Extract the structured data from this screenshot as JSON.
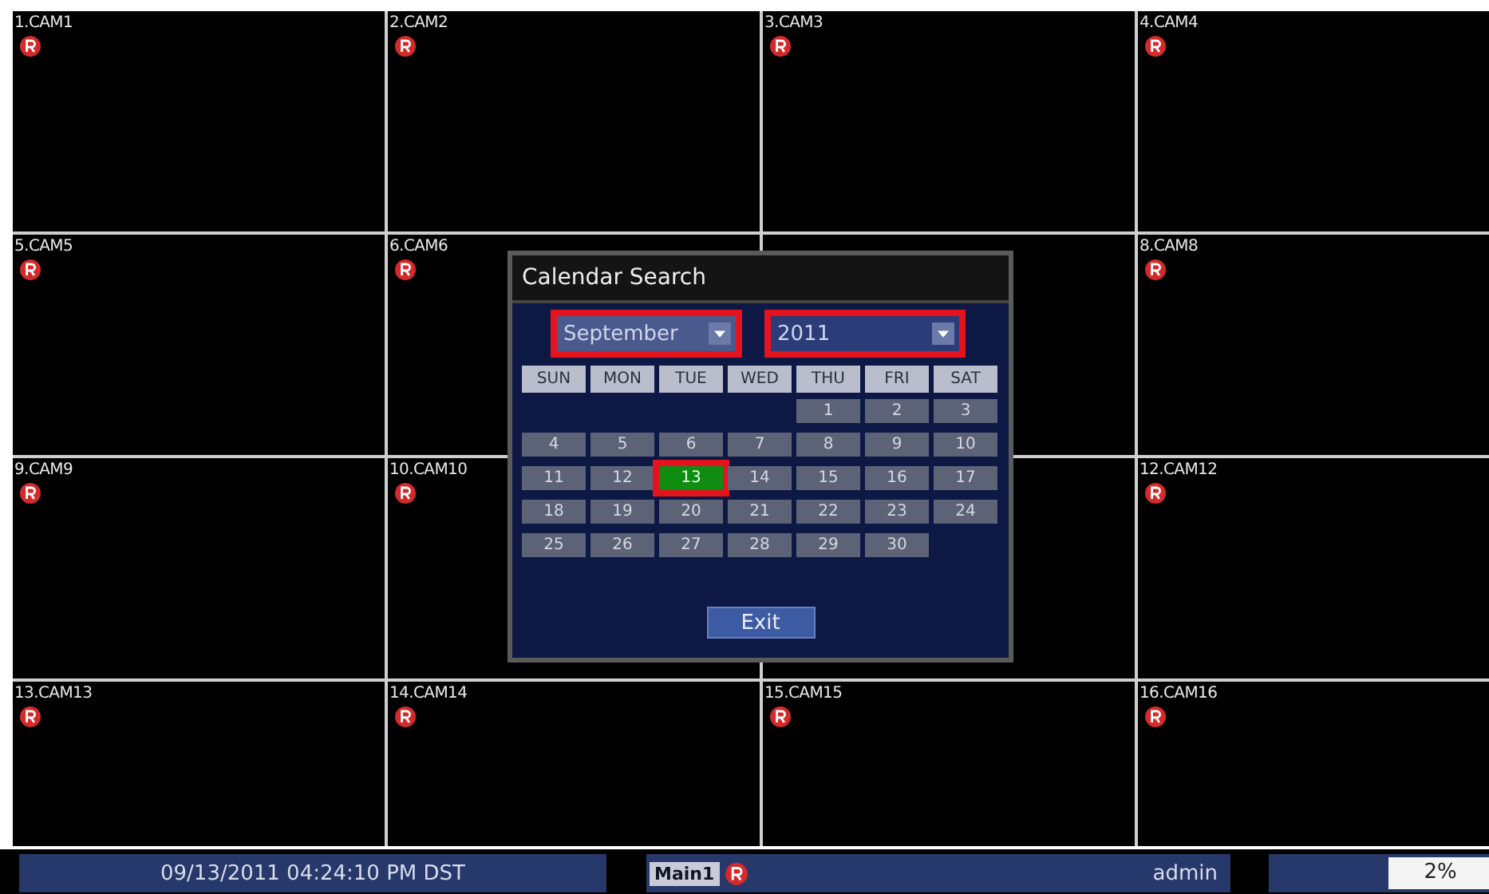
{
  "cameras": [
    {
      "label": "1.CAM1",
      "recording": true
    },
    {
      "label": "2.CAM2",
      "recording": true
    },
    {
      "label": "3.CAM3",
      "recording": true
    },
    {
      "label": "4.CAM4",
      "recording": true
    },
    {
      "label": "5.CAM5",
      "recording": true
    },
    {
      "label": "6.CAM6",
      "recording": true
    },
    {
      "recording": false
    },
    {
      "label": "8.CAM8",
      "recording": true
    },
    {
      "label": "9.CAM9",
      "recording": true
    },
    {
      "label": "10.CAM10",
      "recording": true
    },
    {
      "recording": false
    },
    {
      "label": "12.CAM12",
      "recording": true
    },
    {
      "label": "13.CAM13",
      "recording": true
    },
    {
      "label": "14.CAM14",
      "recording": true
    },
    {
      "label": "15.CAM15",
      "recording": true
    },
    {
      "label": "16.CAM16",
      "recording": true
    }
  ],
  "dialog": {
    "title": "Calendar Search",
    "month": {
      "value": "September",
      "highlighted": true
    },
    "year": {
      "value": "2011",
      "highlighted": true
    },
    "weekdays": [
      "SUN",
      "MON",
      "TUE",
      "WED",
      "THU",
      "FRI",
      "SAT"
    ],
    "weeks": [
      [
        {
          "kind": "blank"
        },
        {
          "kind": "blank"
        },
        {
          "kind": "blank"
        },
        {
          "kind": "blank"
        },
        {
          "day": "1",
          "selected": false
        },
        {
          "day": "2",
          "selected": false
        },
        {
          "day": "3",
          "selected": false
        }
      ],
      [
        {
          "day": "4",
          "selected": false
        },
        {
          "day": "5",
          "selected": false
        },
        {
          "day": "6",
          "selected": false
        },
        {
          "day": "7",
          "selected": false
        },
        {
          "day": "8",
          "selected": false
        },
        {
          "day": "9",
          "selected": false
        },
        {
          "day": "10",
          "selected": false
        }
      ],
      [
        {
          "day": "11",
          "selected": false
        },
        {
          "day": "12",
          "selected": false
        },
        {
          "day": "13",
          "selected": true
        },
        {
          "day": "14",
          "selected": false
        },
        {
          "day": "15",
          "selected": false
        },
        {
          "day": "16",
          "selected": false
        },
        {
          "day": "17",
          "selected": false
        }
      ],
      [
        {
          "day": "18",
          "selected": false
        },
        {
          "day": "19",
          "selected": false
        },
        {
          "day": "20",
          "selected": false
        },
        {
          "day": "21",
          "selected": false
        },
        {
          "day": "22",
          "selected": false
        },
        {
          "day": "23",
          "selected": false
        },
        {
          "day": "24",
          "selected": false
        }
      ],
      [
        {
          "day": "25",
          "selected": false
        },
        {
          "day": "26",
          "selected": false
        },
        {
          "day": "27",
          "selected": false
        },
        {
          "day": "28",
          "selected": false
        },
        {
          "day": "29",
          "selected": false
        },
        {
          "day": "30",
          "selected": false
        },
        {
          "kind": "blank"
        }
      ]
    ],
    "exit_button": "Exit"
  },
  "status_bar": {
    "datetime": "09/13/2011 04:24:10 PM DST",
    "view": "Main1",
    "recording": true,
    "user": "admin",
    "usage": "2%"
  }
}
